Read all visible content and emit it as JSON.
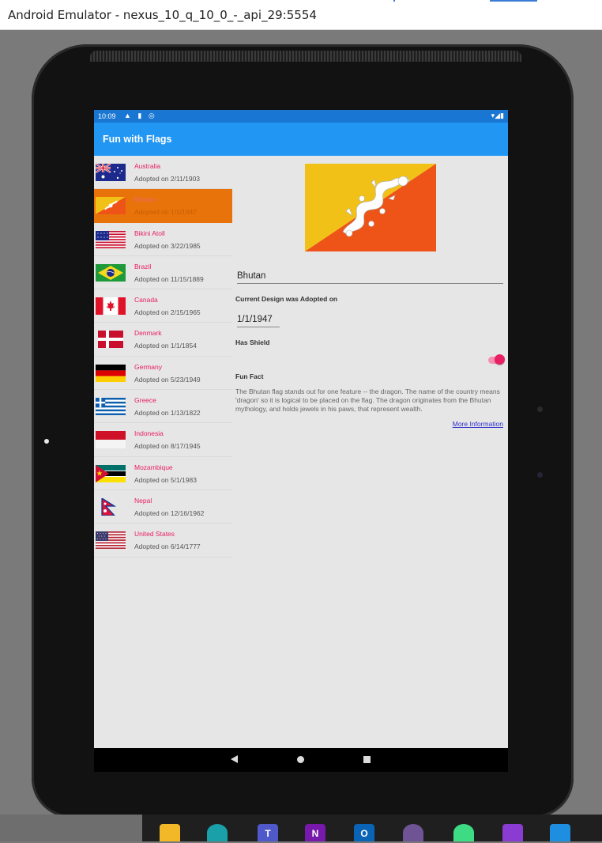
{
  "window": {
    "title": "Android Emulator - nexus_10_q_10_0_-_api_29:5554"
  },
  "status_bar": {
    "time": "10:09",
    "left_icons": "▲ ▮ ◎",
    "right_icons": "▾◢▮"
  },
  "app": {
    "title": "Fun with Flags"
  },
  "flags": [
    {
      "name": "Australia",
      "adopted": "Adopted on 2/11/1903",
      "flag_icon": "australia-flag"
    },
    {
      "name": "Bhutan",
      "adopted": "Adopted on 1/1/1947",
      "flag_icon": "bhutan-flag",
      "selected": true
    },
    {
      "name": "Bikini Atoll",
      "adopted": "Adopted on 3/22/1985",
      "flag_icon": "bikini-atoll-flag"
    },
    {
      "name": "Brazil",
      "adopted": "Adopted on 11/15/1889",
      "flag_icon": "brazil-flag"
    },
    {
      "name": "Canada",
      "adopted": "Adopted on 2/15/1965",
      "flag_icon": "canada-flag"
    },
    {
      "name": "Denmark",
      "adopted": "Adopted on 1/1/1854",
      "flag_icon": "denmark-flag"
    },
    {
      "name": "Germany",
      "adopted": "Adopted on 5/23/1949",
      "flag_icon": "germany-flag"
    },
    {
      "name": "Greece",
      "adopted": "Adopted on 1/13/1822",
      "flag_icon": "greece-flag"
    },
    {
      "name": "Indonesia",
      "adopted": "Adopted on 8/17/1945",
      "flag_icon": "indonesia-flag"
    },
    {
      "name": "Mozambique",
      "adopted": "Adopted on 5/1/1983",
      "flag_icon": "mozambique-flag"
    },
    {
      "name": "Nepal",
      "adopted": "Adopted on 12/16/1962",
      "flag_icon": "nepal-flag"
    },
    {
      "name": "United States",
      "adopted": "Adopted on 6/14/1777",
      "flag_icon": "united-states-flag"
    }
  ],
  "detail": {
    "name_value": "Bhutan",
    "adopted_label": "Current Design was Adopted on",
    "adopted_value": "1/1/1947",
    "shield_label": "Has Shield",
    "has_shield": true,
    "fun_fact_label": "Fun Fact",
    "fun_fact": "The Bhutan flag stands out for one feature -- the dragon. The name of the country means 'dragon' so it is logical to be placed on the flag. The dragon originates from the Bhutan mythology, and holds jewels in his paws, that represent wealth.",
    "more_info": "More Information"
  },
  "colors": {
    "status_bar": "#1976d2",
    "app_bar": "#2196f3",
    "accent": "#e91e63",
    "selected_row": "#e8730a",
    "bhutan_yellow": "#f2c118",
    "bhutan_orange": "#ee5417"
  },
  "taskbar": {
    "icons": [
      "file-explorer-icon",
      "edge-icon",
      "teams-icon",
      "onenote-icon",
      "outlook-icon",
      "github-icon",
      "android-studio-icon",
      "visual-studio-icon",
      "vscode-icon"
    ],
    "labels": {
      "teams": "T",
      "onenote": "N",
      "outlook": "O"
    }
  }
}
